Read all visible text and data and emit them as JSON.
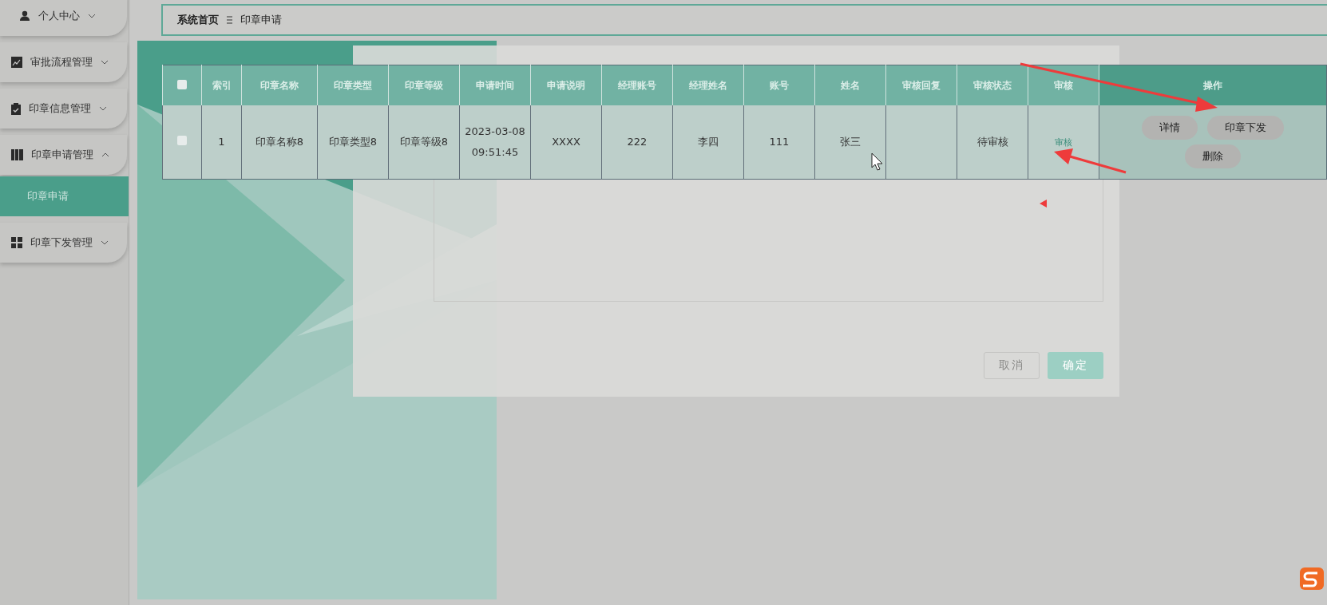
{
  "sidebar": {
    "items": [
      {
        "label": "个人中心",
        "expanded": false
      },
      {
        "label": "审批流程管理",
        "expanded": false
      },
      {
        "label": "印章信息管理",
        "expanded": false
      },
      {
        "label": "印章申请管理",
        "expanded": true,
        "children": [
          {
            "label": "印章申请",
            "selected": true
          }
        ]
      },
      {
        "label": "印章下发管理",
        "expanded": false
      }
    ]
  },
  "breadcrumb": [
    "系统首页",
    "印章申请"
  ],
  "dialog": {
    "buttons": [
      {
        "label": "取消",
        "kind": "cancel"
      },
      {
        "label": "确定",
        "kind": "confirm"
      }
    ]
  },
  "table": {
    "all_checked": false,
    "columns": [
      "索引",
      "印章名称",
      "印章类型",
      "印章等级",
      "申请时间",
      "申请说明",
      "经理账号",
      "经理姓名",
      "账号",
      "姓名",
      "审核回复",
      "审核状态",
      "审核",
      "操作"
    ],
    "rows": [
      {
        "checked": false,
        "cells": [
          "1",
          "印章名称8",
          "印章类型8",
          "印章等级8",
          "2023-03-08 09:51:45",
          "XXXX",
          "222",
          "李四",
          "111",
          "张三",
          null,
          "待审核"
        ],
        "review_link": "审核",
        "actions": [
          "详情",
          "印章下发",
          "删除"
        ]
      }
    ]
  }
}
